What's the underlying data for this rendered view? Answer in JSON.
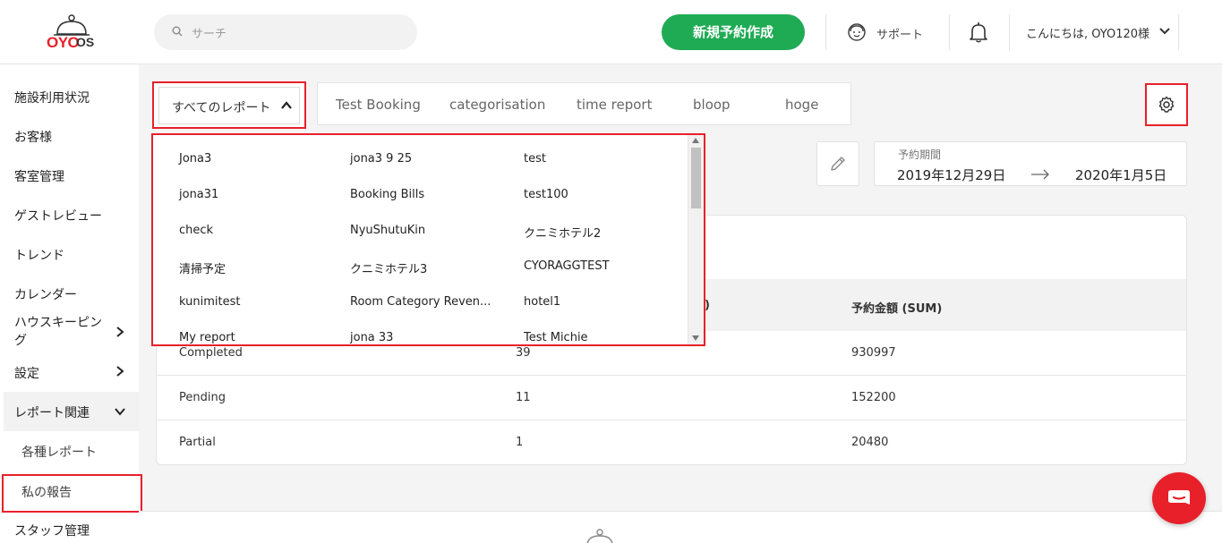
{
  "header": {
    "logo_text": "OYO",
    "logo_suffix": "OS",
    "search_placeholder": "サーチ",
    "new_booking_label": "新規予約作成",
    "support_label": "サポート",
    "greeting": "こんにちは, OYO120様"
  },
  "sidebar": {
    "items": [
      {
        "label": "施設利用状況"
      },
      {
        "label": "お客様"
      },
      {
        "label": "客室管理"
      },
      {
        "label": "ゲストレビュー"
      },
      {
        "label": "トレンド"
      },
      {
        "label": "カレンダー"
      },
      {
        "label": "ハウスキーピング"
      },
      {
        "label": "設定"
      },
      {
        "label": "レポート関連"
      },
      {
        "label": "各種レポート"
      },
      {
        "label": "私の報告"
      },
      {
        "label": "スタッフ管理"
      }
    ]
  },
  "reports": {
    "selector_label": "すべてのレポート",
    "tabs": [
      "Test Booking",
      "categorisation",
      "time report",
      "bloop",
      "hoge"
    ],
    "dropdown_items": [
      [
        "Jona3",
        "jona3 9 25",
        "test"
      ],
      [
        "jona31",
        "Booking Bills",
        "test100"
      ],
      [
        "check",
        "NyuShutuKin",
        "クニミホテル2"
      ],
      [
        "清掃予定",
        "クニミホテル3",
        "CYORAGGTEST"
      ],
      [
        "kunimitest",
        "Room Category Reven...",
        "hotel1"
      ],
      [
        "My report",
        "jona 33",
        "Test Michie"
      ]
    ]
  },
  "date_range": {
    "caption": "予約期間",
    "start": "2019年12月29日",
    "end": "2020年1月5日"
  },
  "table": {
    "headers": [
      "",
      ")",
      "予約金額 (SUM)"
    ],
    "rows": [
      [
        "Completed",
        "39",
        "930997"
      ],
      [
        "Pending",
        "11",
        "152200"
      ],
      [
        "Partial",
        "1",
        "20480"
      ]
    ]
  },
  "colors": {
    "brand_red": "#e8202a",
    "primary_green": "#1fab54"
  }
}
